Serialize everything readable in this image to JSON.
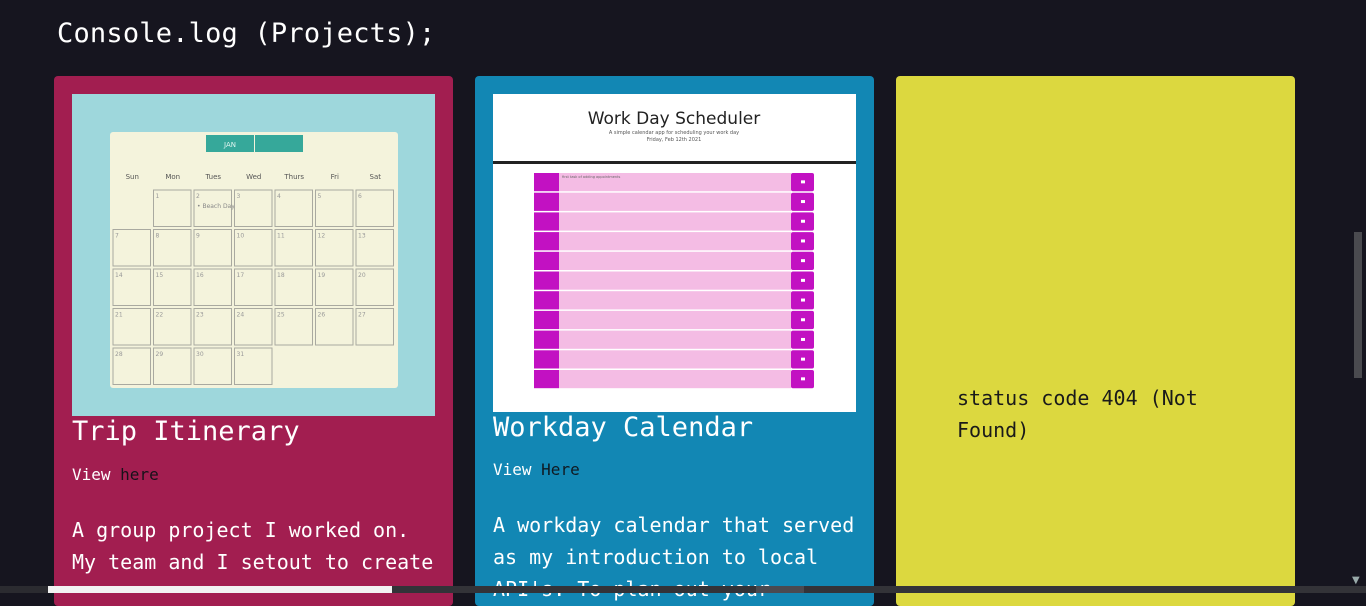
{
  "page": {
    "heading": "Console.log (Projects);"
  },
  "cards": [
    {
      "title": "Trip Itinerary",
      "view_prefix": "View",
      "view_link": "here",
      "description": "A group project I worked on. My team and I setout to create",
      "color": "#a21e50",
      "thumbnail": {
        "month_tabs": [
          "JAN",
          ""
        ],
        "weekdays": [
          "Sun",
          "Mon",
          "Tues",
          "Wed",
          "Thurs",
          "Fri",
          "Sat"
        ],
        "event": "• Beach Day"
      }
    },
    {
      "title": "Workday Calendar",
      "view_prefix": "View",
      "view_link": "Here",
      "description": "A workday calendar that served as my introduction to local API's. To plan out your",
      "color": "#1287b4",
      "thumbnail": {
        "app_title": "Work Day Scheduler",
        "subtitle": "A simple calendar app for scheduling your work day",
        "date": "Friday, Feb 12th 2021",
        "first_row_text": "first task of adding appointments",
        "row_count": 11
      }
    },
    {
      "error_text": "status code 404 (Not Found)",
      "color": "#dcd83f"
    }
  ]
}
